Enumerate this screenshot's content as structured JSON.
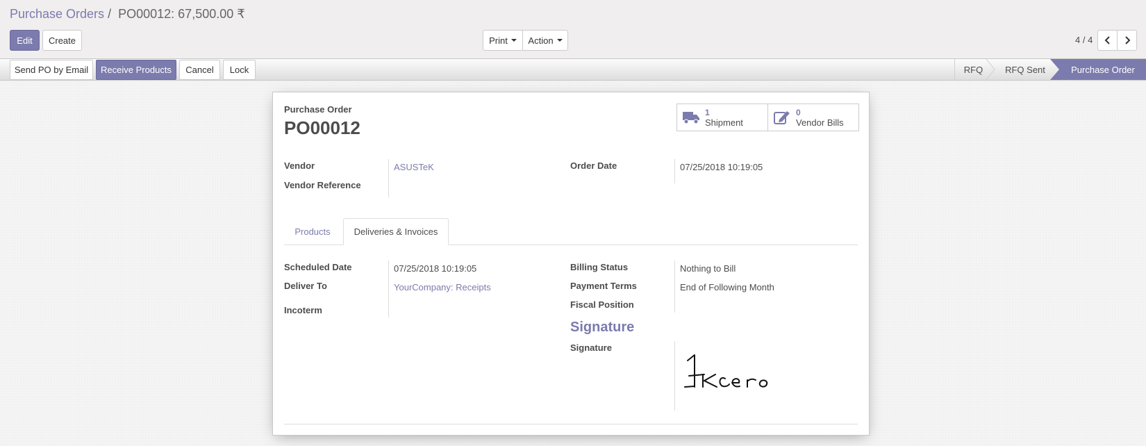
{
  "breadcrumb": {
    "parent": "Purchase Orders",
    "separator": "/",
    "current": "PO00012: 67,500.00 ₹"
  },
  "toolbar": {
    "edit_label": "Edit",
    "create_label": "Create",
    "print_label": "Print",
    "action_label": "Action"
  },
  "pager": {
    "value": "4 / 4"
  },
  "statusbar": {
    "buttons": [
      "Send PO by Email",
      "Receive Products",
      "Cancel",
      "Lock"
    ],
    "stages": [
      "RFQ",
      "RFQ Sent",
      "Purchase Order"
    ],
    "active_stage": "Purchase Order"
  },
  "colors": {
    "brand": "#7c7bad",
    "active_stage_bg": "#7c7bad"
  },
  "sheet": {
    "doc_label": "Purchase Order",
    "doc_name": "PO00012",
    "smart_buttons": [
      {
        "icon": "truck-icon",
        "count": "1",
        "label": "Shipment"
      },
      {
        "icon": "edit-icon",
        "count": "0",
        "label": "Vendor Bills"
      }
    ],
    "vendor_label": "Vendor",
    "vendor_value": "ASUSTeK",
    "vendor_ref_label": "Vendor Reference",
    "order_date_label": "Order Date",
    "order_date_value": "07/25/2018 10:19:05",
    "tabs": [
      "Products",
      "Deliveries & Invoices"
    ],
    "active_tab": "Deliveries & Invoices",
    "deliveries": {
      "scheduled_date_label": "Scheduled Date",
      "scheduled_date_value": "07/25/2018 10:19:05",
      "deliver_to_label": "Deliver To",
      "deliver_to_value": "YourCompany: Receipts",
      "incoterm_label": "Incoterm",
      "billing_status_label": "Billing Status",
      "billing_status_value": "Nothing to Bill",
      "payment_terms_label": "Payment Terms",
      "payment_terms_value": "End of Following Month",
      "fiscal_position_label": "Fiscal Position",
      "signature_heading": "Signature",
      "signature_label": "Signature"
    }
  }
}
